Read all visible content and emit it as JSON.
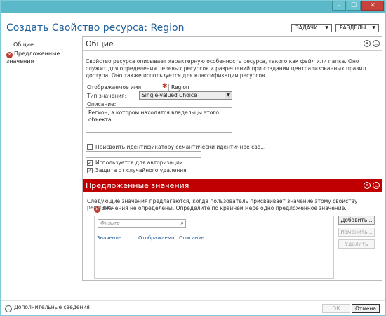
{
  "window": {
    "controls": {
      "minimize": "–",
      "maximize": "☐",
      "close": "✕"
    }
  },
  "header": {
    "title": "Создать Свойство ресурса: Region",
    "tasks_label": "ЗАДАЧИ",
    "sections_label": "РАЗДЕЛЫ",
    "dropdown_arrow": "▼"
  },
  "nav": {
    "items": [
      {
        "label": "Общие"
      },
      {
        "label": "Предложенные значения",
        "error_icon": "✕"
      }
    ]
  },
  "general": {
    "title": "Общие",
    "description": "Свойство ресурса описывает характерную особенность ресурса, такого как файл или папка. Оно служит для определения целевых ресурсов и разрешений при создании централизованных правил доступа. Оно также используется для классификации ресурсов.",
    "display_name_label": "Отображаемое имя:",
    "display_name_value": "Region",
    "required_mark": "✱",
    "value_type_label": "Тип значения:",
    "value_type_value": "Single-valued Choice",
    "select_arrow": "▼",
    "description_label": "Описание:",
    "description_value": "Регион, в котором находятся владельцы этого объекта",
    "semantic_id_label": "Присвоить идентификатору семантически идентичное сво...",
    "semantic_id_value": "",
    "auth_label": "Используется для авторизации",
    "protect_label": "Защита от случайного удаления",
    "check_mark": "✓",
    "btn_close": "✕",
    "btn_collapse": "︿"
  },
  "suggested": {
    "title": "Предложенные значения",
    "info": "Следующие значения предлагаются, когда пользователь присваивает значение этому свойству ресурса:",
    "error": "Значения не определены. Определите по крайней мере одно предложенное значение.",
    "error_icon": "✕",
    "filter_placeholder": "Фильтр",
    "search_icon": "⌕",
    "columns": [
      "Значение",
      "Отображаемо...",
      "Описание"
    ],
    "add_label": "Добавить...",
    "edit_label": "Изменить...",
    "delete_label": "Удалить",
    "btn_close": "✕",
    "btn_collapse": "︿"
  },
  "footer": {
    "more_info": "Дополнительные сведения",
    "expand_icon": "︿",
    "ok_label": "ОК",
    "cancel_label": "Отмена"
  }
}
